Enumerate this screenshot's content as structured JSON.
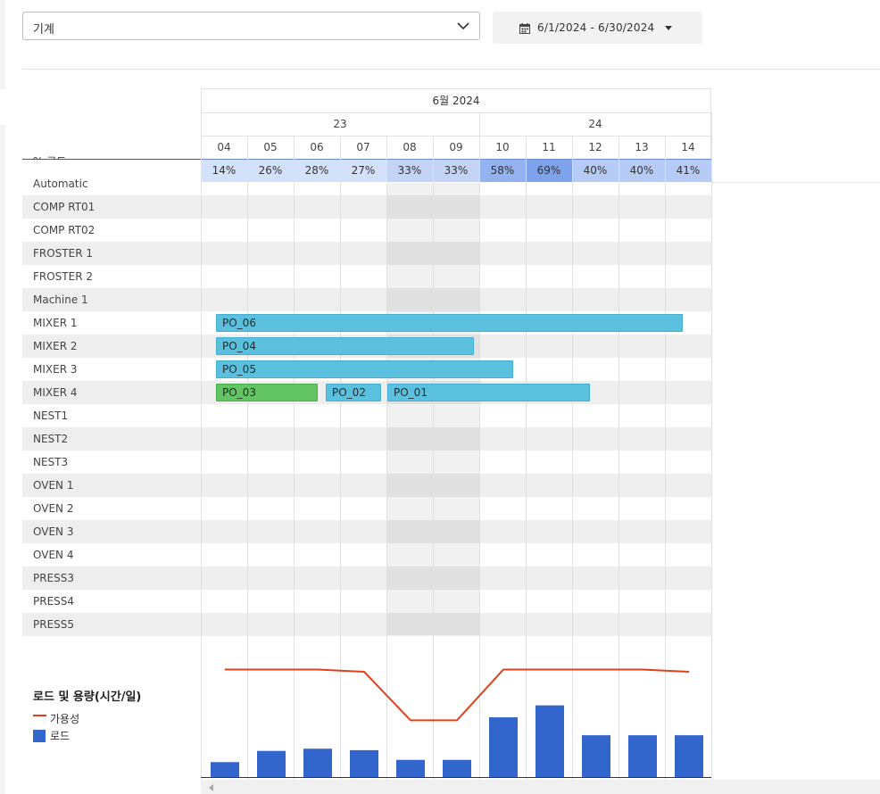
{
  "toolbar": {
    "resource_select_value": "기계",
    "date_range": "6/1/2024 - 6/30/2024"
  },
  "timeline": {
    "month": "6월 2024",
    "weeks": [
      {
        "label": "23",
        "span": 6
      },
      {
        "label": "24",
        "span": 5
      }
    ],
    "days": [
      "04",
      "05",
      "06",
      "07",
      "08",
      "09",
      "10",
      "11",
      "12",
      "13",
      "14"
    ],
    "load_caption": "% 로드",
    "load_percent": [
      "14%",
      "26%",
      "28%",
      "27%",
      "33%",
      "33%",
      "58%",
      "69%",
      "40%",
      "40%",
      "41%"
    ],
    "load_values": [
      14,
      26,
      28,
      27,
      33,
      33,
      58,
      69,
      40,
      40,
      41
    ]
  },
  "resources": [
    "Automatic",
    "COMP RT01",
    "COMP RT02",
    "FROSTER 1",
    "FROSTER 2",
    "Machine 1",
    "MIXER 1",
    "MIXER 2",
    "MIXER 3",
    "MIXER 4",
    "NEST1",
    "NEST2",
    "NEST3",
    "OVEN 1",
    "OVEN 2",
    "OVEN 3",
    "OVEN 4",
    "PRESS3",
    "PRESS4",
    "PRESS5"
  ],
  "orders": [
    {
      "label": "PO_06",
      "resource": "MIXER 1",
      "start_day": 0.33,
      "end_day": 10.38,
      "color": "blue"
    },
    {
      "label": "PO_04",
      "resource": "MIXER 2",
      "start_day": 0.33,
      "end_day": 5.88,
      "color": "blue"
    },
    {
      "label": "PO_05",
      "resource": "MIXER 3",
      "start_day": 0.33,
      "end_day": 6.73,
      "color": "blue"
    },
    {
      "label": "PO_03",
      "resource": "MIXER 4",
      "start_day": 0.33,
      "end_day": 2.53,
      "color": "green"
    },
    {
      "label": "PO_02",
      "resource": "MIXER 4",
      "start_day": 2.69,
      "end_day": 3.88,
      "color": "blue"
    },
    {
      "label": "PO_01",
      "resource": "MIXER 4",
      "start_day": 4.02,
      "end_day": 8.38,
      "color": "blue"
    }
  ],
  "colors": {
    "bar_blue": "#5bc0de",
    "bar_green": "#62c462",
    "chart_load": "#3366cc",
    "chart_availability": "#e0401a"
  },
  "chart_legend": {
    "title": "로드 및 용량(시간/일)",
    "availability_label": "가용성",
    "load_label": "로드"
  },
  "chart_data": {
    "type": "bar",
    "categories": [
      "04",
      "05",
      "06",
      "07",
      "08",
      "09",
      "10",
      "11",
      "12",
      "13",
      "14"
    ],
    "series": [
      {
        "name": "로드",
        "type": "bar",
        "values": [
          2.0,
          3.5,
          3.8,
          3.6,
          2.3,
          2.3,
          8.0,
          9.6,
          5.6,
          5.6,
          5.6
        ]
      },
      {
        "name": "가용성",
        "type": "line",
        "values": [
          14.4,
          14.4,
          14.4,
          14.1,
          7.6,
          7.6,
          14.4,
          14.4,
          14.4,
          14.4,
          14.1
        ]
      }
    ],
    "ylim": [
      0,
      19
    ]
  }
}
